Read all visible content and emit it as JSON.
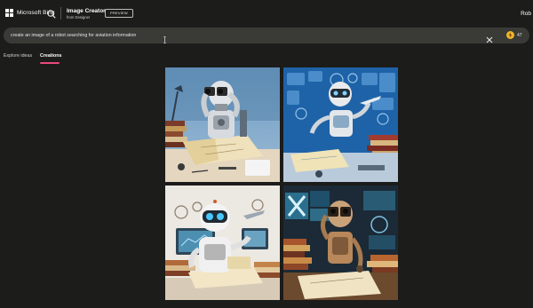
{
  "header": {
    "brand_label": "Microsoft Bing",
    "app_title": "Image Creator",
    "app_subtitle": "from Designer",
    "preview_label": "PREVIEW",
    "user_name": "Rob"
  },
  "prompt": {
    "value": "create an image of a robot searching for aviation information",
    "boost_count": "47"
  },
  "tabs": [
    {
      "label": "Explore ideas"
    },
    {
      "label": "Creations"
    }
  ],
  "colors": {
    "accent": "#e8497a",
    "coin": "#f0b429",
    "background": "#1c1c1a",
    "prompt_bar": "#3a3a37"
  },
  "icons": [
    "microsoft-logo-icon",
    "search-icon",
    "text-cursor-icon",
    "close-icon",
    "coin-icon"
  ],
  "gallery": {
    "images": [
      {
        "subject": "robot-binoculars-map"
      },
      {
        "subject": "robot-blue-dashboard"
      },
      {
        "subject": "robot-cartoon-monitors"
      },
      {
        "subject": "robot-binoculars-screens"
      }
    ]
  }
}
